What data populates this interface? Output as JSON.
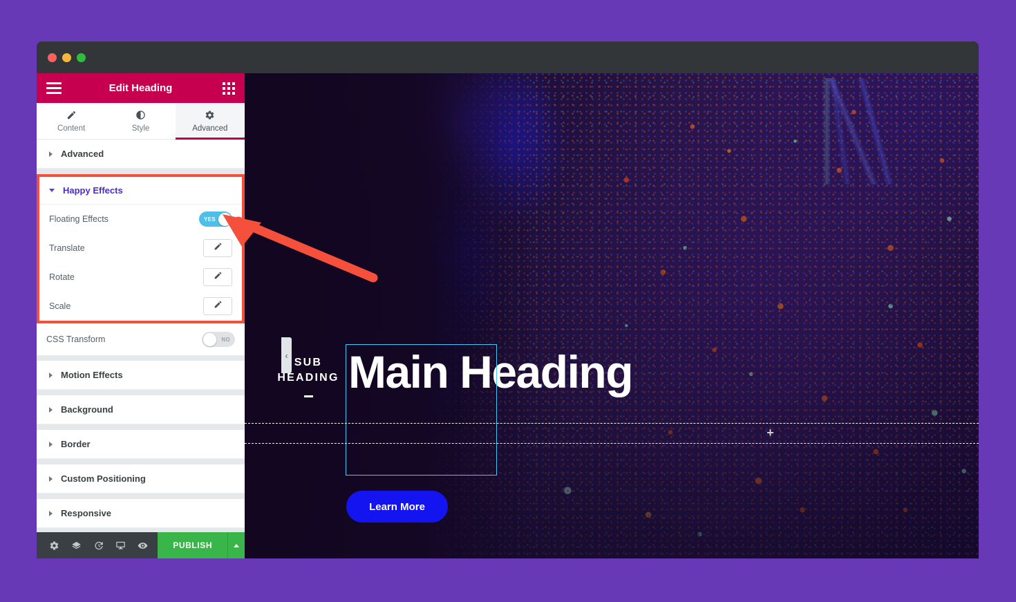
{
  "window": {
    "traffic_lights": [
      "close",
      "minimize",
      "maximize"
    ]
  },
  "panel": {
    "header": {
      "title": "Edit Heading",
      "menu_icon": "hamburger-icon",
      "grid_icon": "grid-icon"
    },
    "tabs": [
      {
        "label": "Content",
        "icon": "pencil-icon",
        "active": false
      },
      {
        "label": "Style",
        "icon": "contrast-icon",
        "active": false
      },
      {
        "label": "Advanced",
        "icon": "gear-icon",
        "active": true
      }
    ],
    "sections_above": [
      {
        "label": "Advanced",
        "expanded": false
      }
    ],
    "happy_effects": {
      "title": "Happy Effects",
      "expanded": true,
      "highlight_color": "#f4503c",
      "title_color": "#4a29d6",
      "controls": [
        {
          "label": "Floating Effects",
          "type": "toggle",
          "value": "YES",
          "on": true
        },
        {
          "label": "Translate",
          "type": "edit",
          "icon": "pencil-icon"
        },
        {
          "label": "Rotate",
          "type": "edit",
          "icon": "pencil-icon"
        },
        {
          "label": "Scale",
          "type": "edit",
          "icon": "pencil-icon"
        }
      ]
    },
    "css_transform": {
      "label": "CSS Transform",
      "type": "toggle",
      "value": "NO",
      "on": false
    },
    "sections_below": [
      {
        "label": "Motion Effects",
        "expanded": false
      },
      {
        "label": "Background",
        "expanded": false
      },
      {
        "label": "Border",
        "expanded": false
      },
      {
        "label": "Custom Positioning",
        "expanded": false
      },
      {
        "label": "Responsive",
        "expanded": false
      }
    ],
    "footer": {
      "icons": [
        {
          "name": "settings-gear-icon"
        },
        {
          "name": "navigator-layers-icon"
        },
        {
          "name": "history-icon"
        },
        {
          "name": "responsive-mode-icon"
        },
        {
          "name": "preview-eye-icon"
        }
      ],
      "publish_label": "PUBLISH",
      "publish_color": "#39b54a",
      "publish_caret": "caret-up-icon"
    },
    "collapse_handle": "‹"
  },
  "canvas": {
    "subheading": "SUB\nHEADING",
    "subheading_line1": "SUB",
    "subheading_line2": "HEADING",
    "main_heading": "Main Heading",
    "cta_label": "Learn More",
    "cta_color": "#1414f0",
    "selection_border_color": "#44c8f5",
    "plus_marker": "+",
    "guides": [
      "guide-top",
      "guide-bottom"
    ]
  },
  "annotation": {
    "arrow_color": "#f4503c",
    "arrow_points_to": "Floating Effects toggle"
  },
  "colors": {
    "page_background": "#6739b7",
    "titlebar": "#333638",
    "panel_header": "#c6004f",
    "accent_pink": "#c6004f",
    "toggle_on": "#4cc0e8",
    "toggle_off": "#e0e2e5",
    "canvas_background": "#1a0a28"
  }
}
